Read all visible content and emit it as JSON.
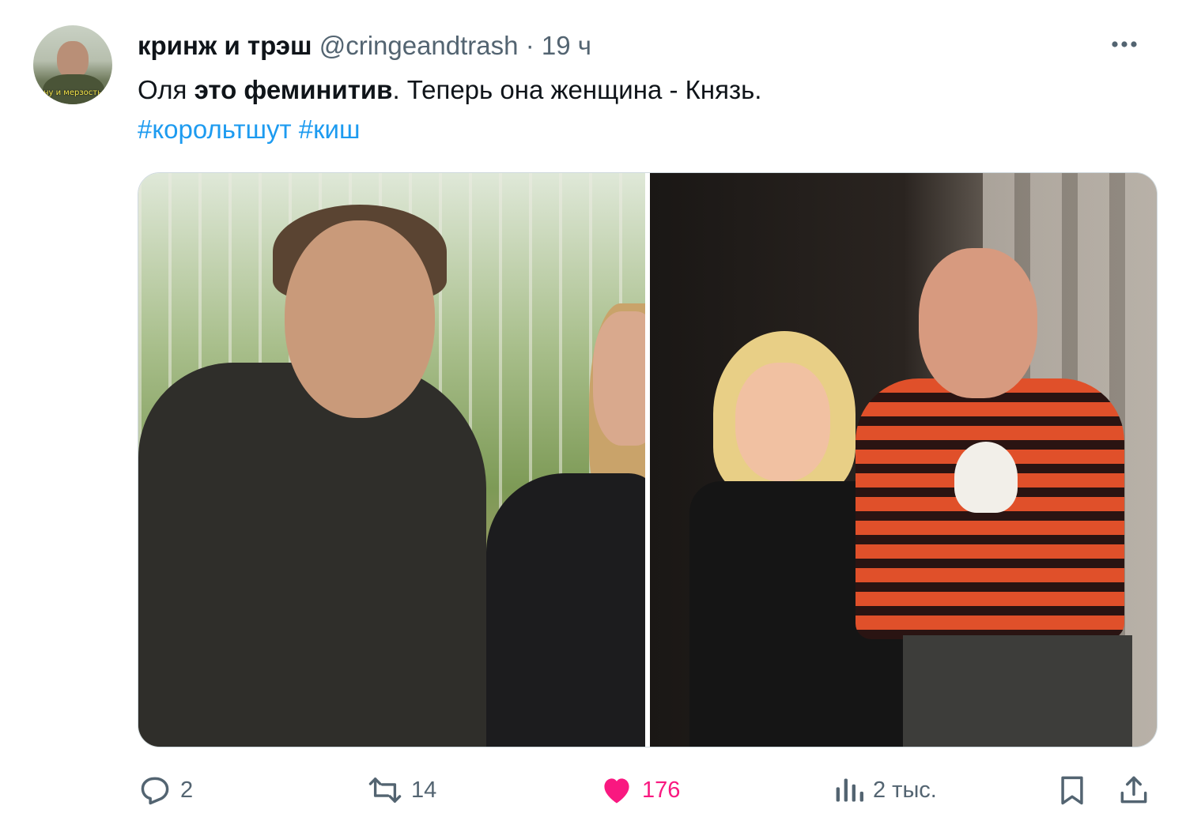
{
  "author": {
    "display_name": "кринж и трэш",
    "handle": "@cringeandtrash",
    "separator": "·",
    "time": "19 ч",
    "avatar_caption": "ну и мерзость"
  },
  "tweet": {
    "text_before": "Оля ",
    "text_bold": "это феминитив",
    "text_after": ". Теперь она женщина - Князь.",
    "hashtags": [
      "#корольтшут",
      "#киш"
    ]
  },
  "actions": {
    "replies": "2",
    "retweets": "14",
    "likes": "176",
    "views": "2 тыс."
  },
  "colors": {
    "link": "#1d9bf0",
    "like": "#f91880",
    "muted": "#536471"
  },
  "icons": [
    "more-icon",
    "reply-icon",
    "retweet-icon",
    "heart-icon",
    "views-icon",
    "bookmark-icon",
    "share-icon"
  ]
}
